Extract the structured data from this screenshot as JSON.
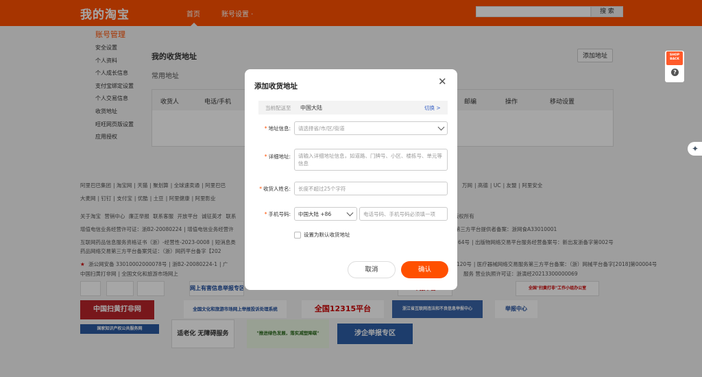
{
  "header": {
    "logo": "我的淘宝",
    "nav_home": "首页",
    "nav_account": "账号设置 ·",
    "search_button": "搜 索"
  },
  "sidebar": {
    "title": "账号管理",
    "items": [
      "安全设置",
      "个人资料",
      "个人成长信息",
      "支付宝绑定设置",
      "个人交易信息",
      "收货地址",
      "旺旺网页版设置",
      "应用授权"
    ]
  },
  "main": {
    "title": "我的收货地址",
    "add_button": "添加地址",
    "subtitle": "常用地址",
    "table_headers": [
      "收货人",
      "电话/手机",
      "邮编",
      "操作",
      "移动设置"
    ]
  },
  "footer": {
    "row1": [
      "阿里巴巴集团",
      "淘宝网",
      "天猫",
      "聚划算",
      "全球速卖通",
      "阿里巴巴",
      "万网",
      "高德",
      "UC",
      "友盟",
      "阿里安全"
    ],
    "row2": [
      "大麦网",
      "钉钉",
      "支付宝",
      "优酷",
      "土豆",
      "阿里健康",
      "阿里影业"
    ],
    "row3": [
      "关于淘宝",
      "营销中心",
      "廉正举报",
      "联系客服",
      "开放平台",
      "诚征英才",
      "联系",
      "m 版权所有"
    ],
    "row4": [
      "增值电信业务经营许可证：浙B2-20080224",
      "增值电信业务经营许",
      "第三方平台提供者备案：浙网食A33010001"
    ],
    "row5": [
      "互联网药品信息服务资格证书（浙）-经营性-2023-0008",
      "短消息类",
      "64号",
      "出版物网络交易平台服务经营备案号：新出发浙备字第002号"
    ],
    "row6": [
      "药品网络交易第三方平台备案凭证：（浙）网药平台备字【202"
    ],
    "row7": [
      "浙公网安备 33010002000078号",
      "浙B2-20080224-1",
      "广",
      "120号",
      "医疗器械网络交易服务第三方平台备案：（浙）网械平台备字[2018]第00004号"
    ],
    "row8": [
      "中国扫黄打非网",
      "全国文化和旅游市场网上",
      "服务 营业执照许可证：浙演经20213300000069"
    ],
    "badges": {
      "police": "网上有害信息举报专区",
      "report_platform": "举报平台",
      "anti_porn": "中国扫黄打非网",
      "culture": "全国文化和旅游市场网上举报投诉处理系统",
      "hotline": "全国12315平台",
      "zj_report": "浙江省互联网违法和不良信息举报中心",
      "report_center": "举报中心",
      "ip_service": "国家知识产权公共服务网",
      "elderly": "适老化 无障碍服务",
      "green": "\"推进绿色发展，落实减塑降碳\"",
      "enterprise": "涉企举报专区",
      "office": "全国\"扫黄打非\"工作小组办公室"
    }
  },
  "widgets": {
    "shopback": "SHOP BACK",
    "help": "?",
    "ai": "✦"
  },
  "modal": {
    "title": "添加收货地址",
    "close": "✕",
    "region_label": "当前配送至",
    "region_value": "中国大陆",
    "region_switch": "切换 >",
    "address_label": "地址信息:",
    "address_placeholder": "请选择省/市/区/街道",
    "detail_label": "详细地址:",
    "detail_placeholder": "请输入详细地址信息，如道路、门牌号、小区、楼栋号、单元等信息",
    "name_label": "收货人姓名:",
    "name_placeholder": "长度不超过25个字符",
    "phone_label": "手机号码:",
    "phone_region": "中国大陆 +86",
    "phone_placeholder": "电话号码、手机号码必须填一项",
    "default_label": "设置为默认收货地址",
    "cancel": "取消",
    "confirm": "确认"
  },
  "colors": {
    "brand": "#ff5000",
    "link": "#3a63c6"
  }
}
